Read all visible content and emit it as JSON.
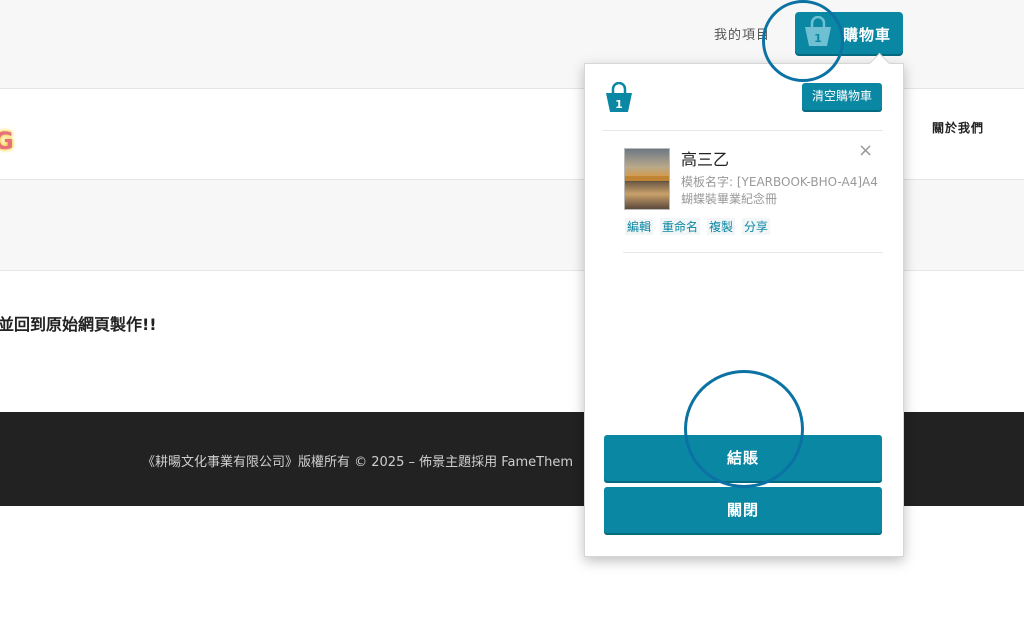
{
  "topbar": {
    "my_projects": "我的項目",
    "cart_label": "購物車",
    "cart_count": "1"
  },
  "header": {
    "logo_fragment": "G",
    "nav_about": "關於我們"
  },
  "main": {
    "message": "並回到原始網頁製作!!"
  },
  "footer": {
    "text": "《耕暘文化事業有限公司》版權所有 © 2025 – 佈景主題採用 FameThem"
  },
  "cart_panel": {
    "count": "1",
    "clear_label": "清空購物車",
    "item": {
      "title": "高三乙",
      "template_line": "模板名字: [YEARBOOK-BHO-A4]A4",
      "subtitle": "蝴蝶裝畢業紀念冊",
      "close_glyph": "×",
      "actions": [
        "編輯",
        "重命名",
        "複製",
        "分享"
      ]
    },
    "checkout_label": "結賬",
    "close_label": "關閉"
  },
  "colors": {
    "accent": "#0a87a3",
    "highlight_ring": "#0b72a3",
    "footer_bg": "#222222"
  },
  "icons": {
    "cart": "shopping-basket-icon",
    "remove": "close-icon"
  }
}
